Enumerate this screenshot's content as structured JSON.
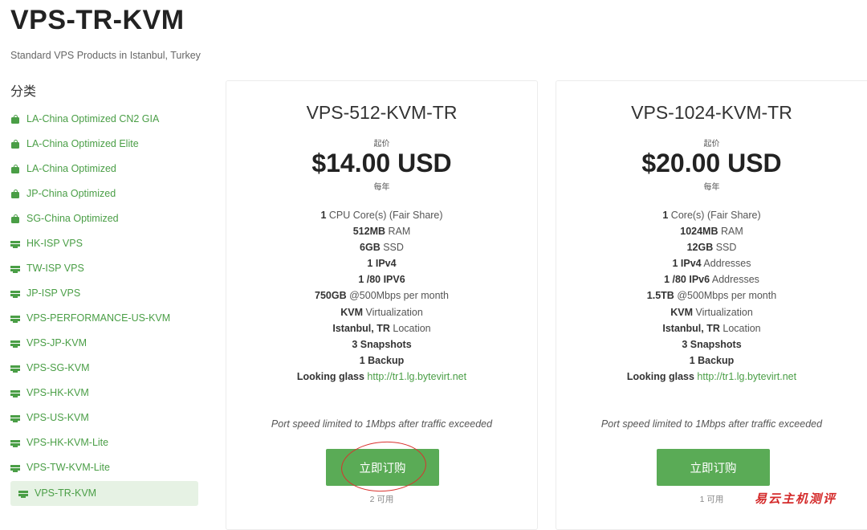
{
  "page": {
    "title": "VPS-TR-KVM",
    "subtitle": "Standard VPS Products in Istanbul, Turkey"
  },
  "sidebar": {
    "heading": "分类",
    "items": [
      {
        "label": "LA-China Optimized CN2 GIA",
        "icon": "shopping-bag-icon"
      },
      {
        "label": "LA-China Optimized Elite",
        "icon": "shopping-bag-icon"
      },
      {
        "label": "LA-China Optimized",
        "icon": "shopping-bag-icon"
      },
      {
        "label": "JP-China Optimized",
        "icon": "shopping-bag-icon"
      },
      {
        "label": "SG-China Optimized",
        "icon": "shopping-bag-icon"
      },
      {
        "label": "HK-ISP VPS",
        "icon": "server-icon"
      },
      {
        "label": "TW-ISP VPS",
        "icon": "server-icon"
      },
      {
        "label": "JP-ISP VPS",
        "icon": "server-icon"
      },
      {
        "label": "VPS-PERFORMANCE-US-KVM",
        "icon": "server-icon"
      },
      {
        "label": "VPS-JP-KVM",
        "icon": "server-icon"
      },
      {
        "label": "VPS-SG-KVM",
        "icon": "server-icon"
      },
      {
        "label": "VPS-HK-KVM",
        "icon": "server-icon"
      },
      {
        "label": "VPS-US-KVM",
        "icon": "server-icon"
      },
      {
        "label": "VPS-HK-KVM-Lite",
        "icon": "server-icon"
      },
      {
        "label": "VPS-TW-KVM-Lite",
        "icon": "server-icon"
      },
      {
        "label": "VPS-TR-KVM",
        "icon": "server-icon",
        "active": true
      }
    ]
  },
  "products": [
    {
      "name": "VPS-512-KVM-TR",
      "from_label": "起价",
      "price": "$14.00 USD",
      "cycle": "每年",
      "features": [
        {
          "bold": "1",
          "text": " CPU Core(s) (Fair Share)"
        },
        {
          "bold": "512MB",
          "text": " RAM"
        },
        {
          "bold": "6GB",
          "text": " SSD"
        },
        {
          "bold": "1 IPv4",
          "text": ""
        },
        {
          "bold": "1 /80 IPV6",
          "text": ""
        },
        {
          "bold": "750GB",
          "text": " @500Mbps per month"
        },
        {
          "bold": "KVM",
          "text": " Virtualization"
        },
        {
          "bold": "Istanbul, TR",
          "text": " Location"
        },
        {
          "bold": "3 Snapshots",
          "text": ""
        },
        {
          "bold": "1 Backup",
          "text": ""
        },
        {
          "bold": "Looking glass",
          "text": " ",
          "link": "http://tr1.lg.bytevirt.net"
        }
      ],
      "note": "Port speed limited to 1Mbps after traffic exceeded",
      "order_label": "立即订购",
      "available": "2 可用"
    },
    {
      "name": "VPS-1024-KVM-TR",
      "from_label": "起价",
      "price": "$20.00 USD",
      "cycle": "每年",
      "features": [
        {
          "bold": "1",
          "text": " Core(s) (Fair Share)"
        },
        {
          "bold": "1024MB",
          "text": " RAM"
        },
        {
          "bold": "12GB",
          "text": " SSD"
        },
        {
          "bold": "1 IPv4",
          "text": " Addresses"
        },
        {
          "bold": "1 /80 IPv6",
          "text": " Addresses"
        },
        {
          "bold": "1.5TB",
          "text": " @500Mbps per month"
        },
        {
          "bold": "KVM",
          "text": " Virtualization"
        },
        {
          "bold": "Istanbul, TR",
          "text": " Location"
        },
        {
          "bold": "3 Snapshots",
          "text": ""
        },
        {
          "bold": "1 Backup",
          "text": ""
        },
        {
          "bold": "Looking glass",
          "text": " ",
          "link": "http://tr1.lg.bytevirt.net"
        }
      ],
      "note": "Port speed limited to 1Mbps after traffic exceeded",
      "order_label": "立即订购",
      "available": "1 可用"
    }
  ],
  "watermark": "易云主机测评",
  "colors": {
    "accent": "#4a9e46",
    "button": "#5aab56",
    "active_bg": "#e6f2e4",
    "annotation_circle": "#d9322e"
  }
}
